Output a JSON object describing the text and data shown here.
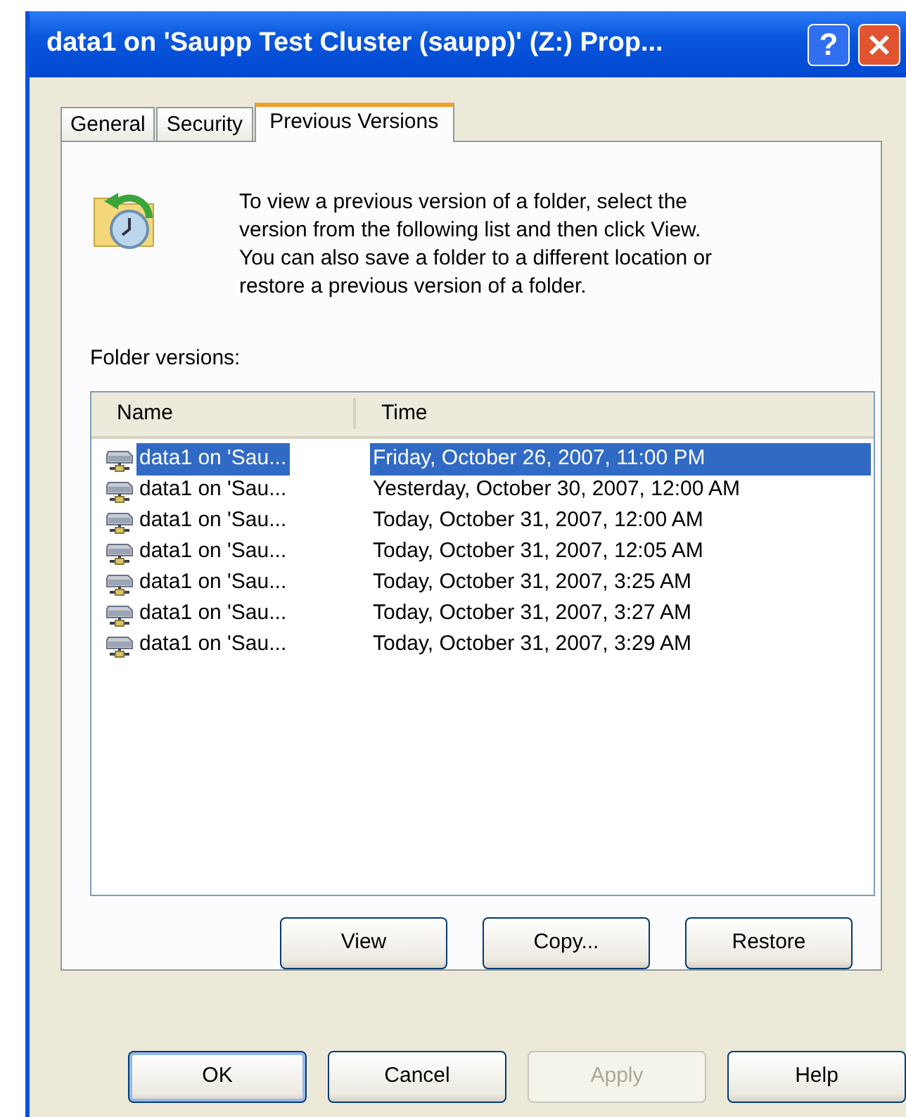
{
  "window": {
    "title": "data1 on 'Saupp Test Cluster (saupp)' (Z:) Prop...",
    "help_glyph": "?"
  },
  "tabs": [
    {
      "label": "General",
      "selected": false
    },
    {
      "label": "Security",
      "selected": false
    },
    {
      "label": "Previous Versions",
      "selected": true
    }
  ],
  "description": "To view a previous version of a folder, select the version from the following list and then click View. You can also save a folder to a different location or restore a previous version of a folder.",
  "list_label": "Folder versions:",
  "table": {
    "columns": [
      "Name",
      "Time"
    ],
    "rows": [
      {
        "name": "data1 on 'Sau...",
        "time": "Friday, October 26, 2007, 11:00 PM",
        "selected": true
      },
      {
        "name": "data1 on 'Sau...",
        "time": "Yesterday, October 30, 2007, 12:00 AM",
        "selected": false
      },
      {
        "name": "data1 on 'Sau...",
        "time": "Today, October 31, 2007, 12:00 AM",
        "selected": false
      },
      {
        "name": "data1 on 'Sau...",
        "time": "Today, October 31, 2007, 12:05 AM",
        "selected": false
      },
      {
        "name": "data1 on 'Sau...",
        "time": "Today, October 31, 2007, 3:25 AM",
        "selected": false
      },
      {
        "name": "data1 on 'Sau...",
        "time": "Today, October 31, 2007, 3:27 AM",
        "selected": false
      },
      {
        "name": "data1 on 'Sau...",
        "time": "Today, October 31, 2007, 3:29 AM",
        "selected": false
      }
    ]
  },
  "panel_buttons": [
    {
      "label": "View",
      "disabled": false
    },
    {
      "label": "Copy...",
      "disabled": false
    },
    {
      "label": "Restore",
      "disabled": false
    }
  ],
  "dialog_buttons": [
    {
      "label": "OK",
      "default": true,
      "disabled": false
    },
    {
      "label": "Cancel",
      "default": false,
      "disabled": false
    },
    {
      "label": "Apply",
      "default": false,
      "disabled": true
    },
    {
      "label": "Help",
      "default": false,
      "disabled": false
    }
  ]
}
